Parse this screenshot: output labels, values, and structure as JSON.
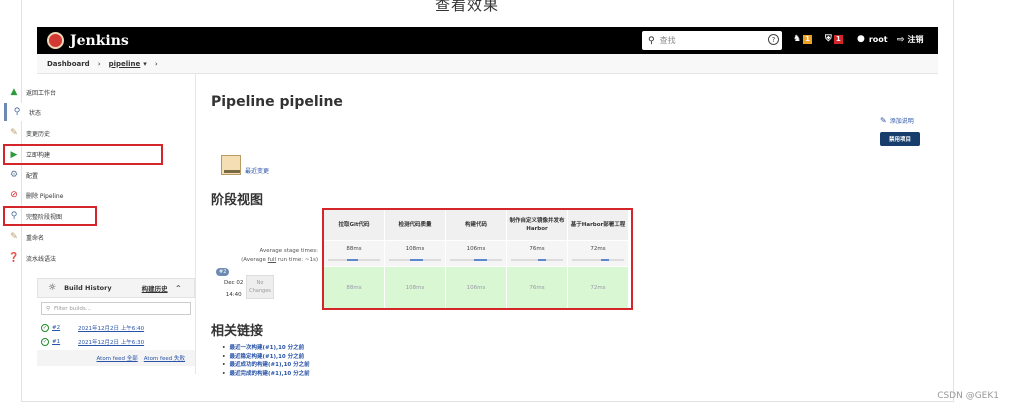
{
  "page_heading": "查看效果",
  "watermark": "CSDN @GEK1",
  "header": {
    "logo_text": "Jenkins",
    "search_placeholder": "查找",
    "notif_count": "1",
    "security_count": "1",
    "user": "root",
    "logout": "注销"
  },
  "breadcrumb": {
    "root": "Dashboard",
    "job": "pipeline"
  },
  "sidebar": {
    "tasks": [
      {
        "label": "返回工作台",
        "icon": "up-arrow-icon"
      },
      {
        "label": "状态",
        "icon": "search-icon"
      },
      {
        "label": "变更历史",
        "icon": "notepad-icon"
      },
      {
        "label": "立即构建",
        "icon": "build-icon"
      },
      {
        "label": "配置",
        "icon": "gear-icon"
      },
      {
        "label": "删除 Pipeline",
        "icon": "no-entry-icon"
      },
      {
        "label": "完整阶段视图",
        "icon": "search-icon"
      },
      {
        "label": "重命名",
        "icon": "notepad-icon"
      },
      {
        "label": "流水线语法",
        "icon": "help-icon"
      }
    ],
    "build_history": {
      "title": "Build History",
      "trend": "构建历史",
      "filter_placeholder": "Filter builds...",
      "builds": [
        {
          "num": "#2",
          "date": "2021年12月2日 上午6:40"
        },
        {
          "num": "#1",
          "date": "2021年12月2日 上午6:30"
        }
      ],
      "feed_all": "Atom feed 全部",
      "feed_fail": "Atom feed 失败"
    }
  },
  "main": {
    "title": "Pipeline pipeline",
    "add_desc": "添加说明",
    "disable_btn": "禁用项目",
    "recent_changes": "最近变更",
    "stage_view_title": "阶段视图",
    "avg_label_1": "Average stage times:",
    "avg_label_2a": "(Average ",
    "avg_label_full": "full",
    "avg_label_2b": " run time: ~1s)",
    "run": {
      "id": "#2",
      "month_day": "Dec 02",
      "time": "14:40",
      "no_changes_1": "No",
      "no_changes_2": "Changes"
    },
    "stages": [
      {
        "name": "拉取Git代码",
        "avg": "88ms",
        "cell": "88ms",
        "bar_pct": 0.2
      },
      {
        "name": "检测代码质量",
        "avg": "108ms",
        "cell": "108ms",
        "bar_pct": 0.25
      },
      {
        "name": "构建代码",
        "avg": "106ms",
        "cell": "106ms",
        "bar_pct": 0.25
      },
      {
        "name": "制作自定义镜像并发布Harbor",
        "avg": "76ms",
        "cell": "76ms",
        "bar_pct": 0.15
      },
      {
        "name": "基于Harbor部署工程",
        "avg": "72ms",
        "cell": "72ms",
        "bar_pct": 0.15
      }
    ],
    "links_title": "相关链接",
    "links": [
      "最近一次构建(#1),10 分之前",
      "最近稳定构建(#1),10 分之前",
      "最近成功的构建(#1),10 分之前",
      "最近完成的构建(#1),10 分之前"
    ]
  },
  "colors": {
    "header_bg": "#000000",
    "highlight": "#d4252b",
    "stage_success": "#d9f7d3",
    "link": "#2953a8"
  }
}
